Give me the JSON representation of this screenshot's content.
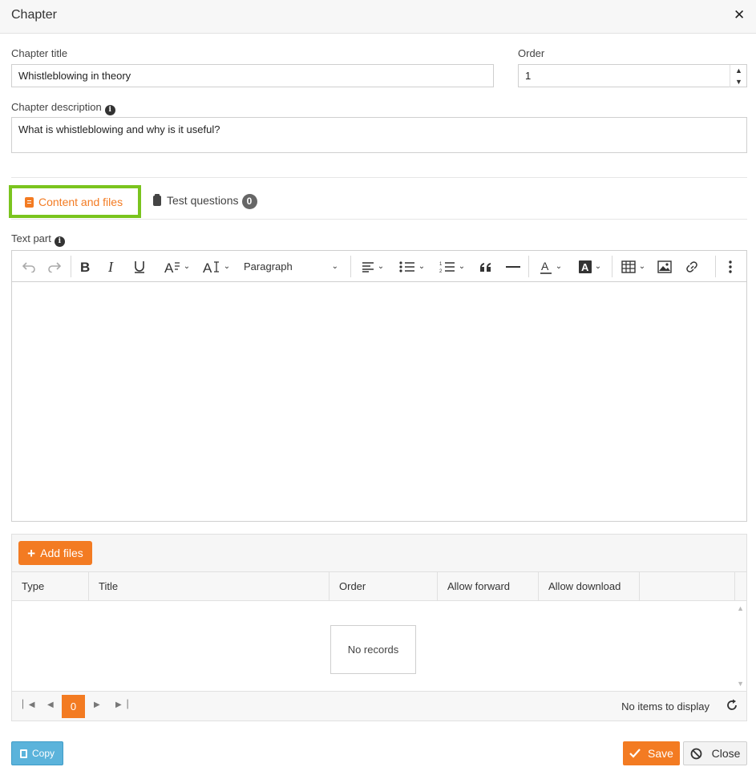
{
  "dialog": {
    "title": "Chapter",
    "close_glyph": "✕"
  },
  "form": {
    "chapter_title_label": "Chapter title",
    "chapter_title_value": "Whistleblowing in theory",
    "order_label": "Order",
    "order_value": "1",
    "description_label": "Chapter description",
    "description_value": "What is whistleblowing and why is it useful?"
  },
  "tabs": [
    {
      "label": "Content and files",
      "icon": "document-icon",
      "active": true
    },
    {
      "label": "Test questions",
      "icon": "clipboard-icon",
      "badge": "0"
    }
  ],
  "editor": {
    "label": "Text part",
    "paragraph_select": "Paragraph"
  },
  "files": {
    "add_label": "Add files",
    "columns": [
      "Type",
      "Title",
      "Order",
      "Allow forward",
      "Allow download"
    ],
    "empty_text": "No records",
    "page_current": "0",
    "pager_info": "No items to display"
  },
  "footer": {
    "copy_label": "Copy",
    "save_label": "Save",
    "close_label": "Close"
  },
  "colors": {
    "accent": "#f37b22",
    "highlight": "#7ac41e",
    "copy": "#5bb3db"
  }
}
